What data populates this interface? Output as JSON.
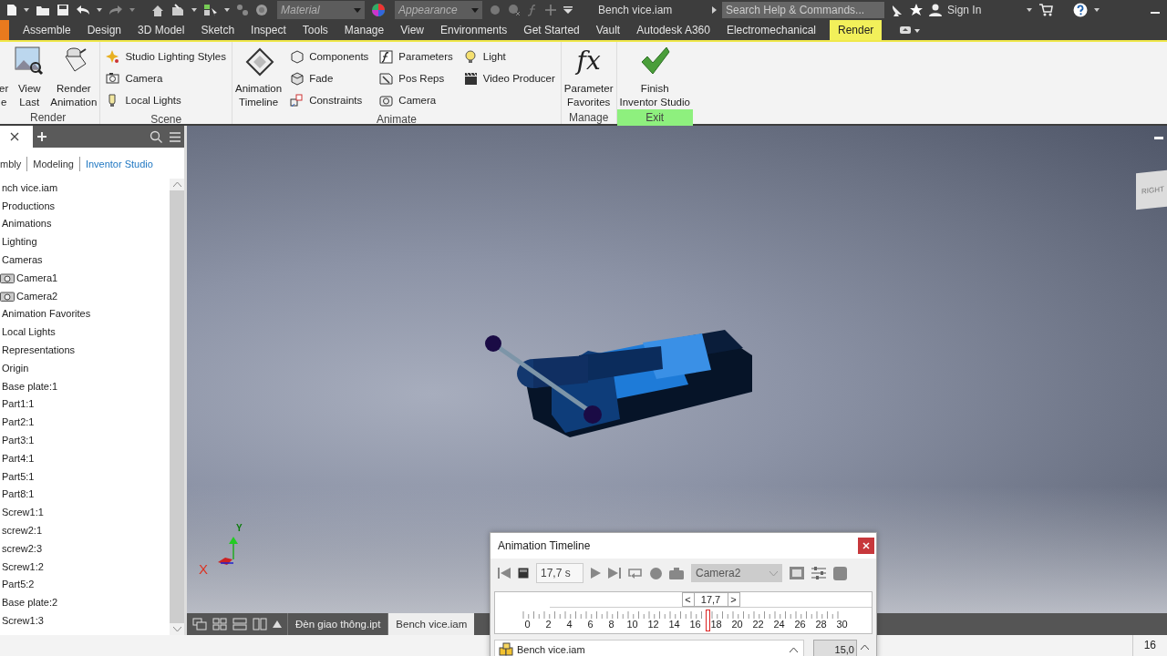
{
  "title_bar": {
    "material": {
      "placeholder": "Material"
    },
    "appearance": {
      "placeholder": "Appearance"
    },
    "document_title": "Bench vice.iam",
    "search": {
      "placeholder": "Search Help & Commands..."
    },
    "sign_in": "Sign In"
  },
  "ribbon_tabs": [
    {
      "label": "Assemble",
      "selected": false
    },
    {
      "label": "Design",
      "selected": false
    },
    {
      "label": "3D Model",
      "selected": false
    },
    {
      "label": "Sketch",
      "selected": false
    },
    {
      "label": "Inspect",
      "selected": false
    },
    {
      "label": "Tools",
      "selected": false
    },
    {
      "label": "Manage",
      "selected": false
    },
    {
      "label": "View",
      "selected": false
    },
    {
      "label": "Environments",
      "selected": false
    },
    {
      "label": "Get Started",
      "selected": false
    },
    {
      "label": "Vault",
      "selected": false
    },
    {
      "label": "Autodesk A360",
      "selected": false
    },
    {
      "label": "Electromechanical",
      "selected": false
    },
    {
      "label": "Render",
      "selected": true
    }
  ],
  "ribbon_panels": [
    {
      "title": "Render",
      "highlighted": false,
      "items": [
        {
          "kind": "large",
          "lines": [
            "er",
            "e"
          ]
        },
        {
          "kind": "large",
          "lines": [
            "View",
            "Last"
          ]
        },
        {
          "kind": "large",
          "lines": [
            "Render",
            "Animation"
          ]
        }
      ]
    },
    {
      "title": "Scene",
      "highlighted": false,
      "items": [
        {
          "kind": "column",
          "labels": [
            "Studio Lighting Styles",
            "Camera",
            "Local Lights"
          ]
        }
      ]
    },
    {
      "title": "Animate",
      "highlighted": false,
      "items": [
        {
          "kind": "large",
          "lines": [
            "Animation",
            "Timeline"
          ]
        },
        {
          "kind": "column",
          "labels": [
            "Components",
            "Fade",
            "Constraints"
          ]
        },
        {
          "kind": "column",
          "labels": [
            "Parameters",
            "Pos Reps",
            "Camera"
          ]
        },
        {
          "kind": "column",
          "labels": [
            "Light",
            "Video Producer"
          ]
        }
      ]
    },
    {
      "title": "Manage",
      "highlighted": false,
      "items": [
        {
          "kind": "symbol",
          "symbol": "fx",
          "lines": [
            "Parameter",
            "Favorites"
          ]
        }
      ]
    },
    {
      "title": "Exit",
      "highlighted": true,
      "items": [
        {
          "kind": "large",
          "lines": [
            "Finish",
            "Inventor Studio"
          ]
        }
      ]
    }
  ],
  "browser": {
    "tabs": [
      {
        "label": "mbly",
        "selected": false
      },
      {
        "label": "Modeling",
        "selected": false
      },
      {
        "label": "Inventor Studio",
        "selected": true
      }
    ],
    "tree": [
      {
        "label": "nch vice.iam",
        "children": [
          {
            "label": "Productions"
          },
          {
            "label": "Animations"
          },
          {
            "label": "Lighting"
          },
          {
            "label": "Cameras",
            "children": [
              {
                "label": "Camera1"
              },
              {
                "label": "Camera2"
              }
            ]
          },
          {
            "label": "Animation Favorites"
          },
          {
            "label": "Local Lights"
          },
          {
            "label": "Representations"
          },
          {
            "label": "Origin"
          },
          {
            "label": "Base plate:1"
          },
          {
            "label": "Part1:1"
          },
          {
            "label": "Part2:1"
          },
          {
            "label": "Part3:1"
          },
          {
            "label": "Part4:1"
          },
          {
            "label": "Part5:1"
          },
          {
            "label": "Part8:1"
          },
          {
            "label": "Screw1:1"
          },
          {
            "label": "screw2:1"
          },
          {
            "label": "screw2:3"
          },
          {
            "label": "Screw1:2"
          },
          {
            "label": "Part5:2"
          },
          {
            "label": "Base plate:2"
          },
          {
            "label": "Screw1:3"
          }
        ]
      }
    ]
  },
  "viewport": {
    "view_cube": "RIGHT",
    "axis_x": "X",
    "axis_y": "Y"
  },
  "document_tabs": [
    {
      "label": "Đèn giao thông.ipt",
      "selected": false
    },
    {
      "label": "Bench vice.iam",
      "selected": true
    }
  ],
  "timeline": {
    "title": "Animation Timeline",
    "time": "17,7 s",
    "camera": "Camera2",
    "spinner": "17,7",
    "spin_prev": "<",
    "spin_next": ">",
    "ticks": [
      "0",
      "2",
      "4",
      "6",
      "8",
      "10",
      "12",
      "14",
      "16",
      "18",
      "20",
      "22",
      "24",
      "26",
      "28",
      "30"
    ],
    "level": 0.59,
    "list": [
      {
        "label": "Bench vice.iam"
      }
    ],
    "duration": "15,0"
  },
  "status_bar": {
    "count": "16"
  }
}
